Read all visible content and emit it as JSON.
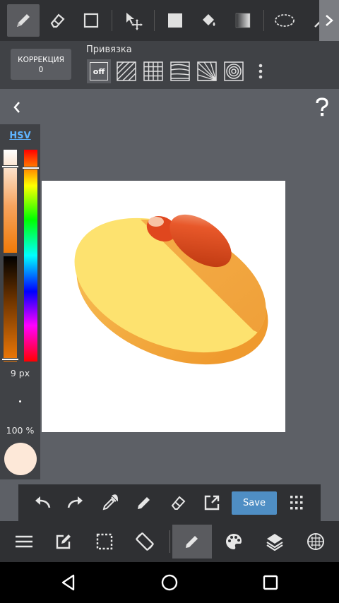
{
  "correction": {
    "label": "КОРРЕКЦИЯ",
    "value": "0"
  },
  "snap": {
    "label": "Привязка",
    "off_label": "off"
  },
  "color_panel": {
    "mode": "HSV",
    "brush_size": "9 px",
    "opacity": "100 %"
  },
  "save_label": "Save",
  "colors": {
    "current": "#fde8d8",
    "link": "#5fb4ff",
    "save_button": "#4f8ec4"
  }
}
